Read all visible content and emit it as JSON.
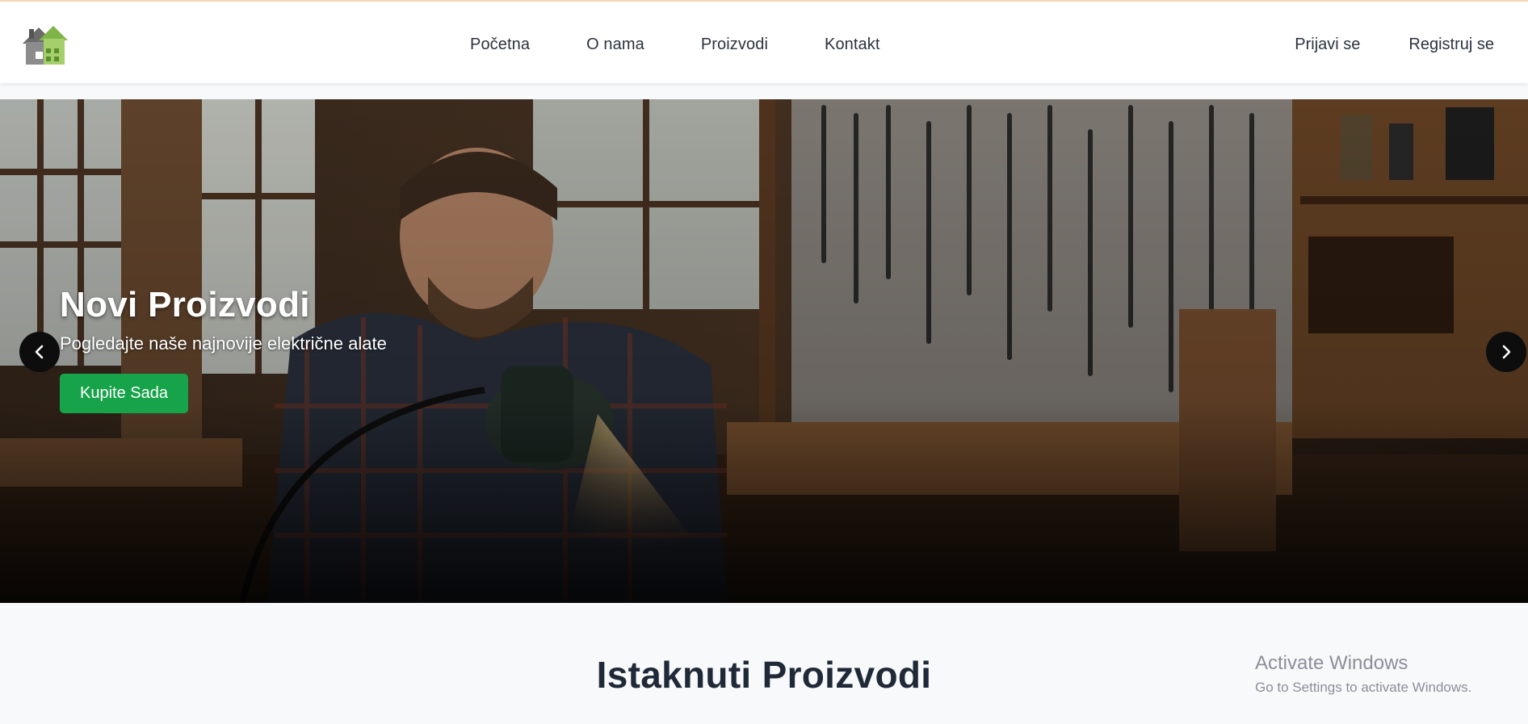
{
  "nav": {
    "links": [
      {
        "label": "Početna"
      },
      {
        "label": "O nama"
      },
      {
        "label": "Proizvodi"
      },
      {
        "label": "Kontakt"
      }
    ],
    "login_label": "Prijavi se",
    "register_label": "Registruj se"
  },
  "hero": {
    "title": "Novi Proizvodi",
    "subtitle": "Pogledajte naše najnovije električne alate",
    "cta_label": "Kupite Sada",
    "prev_icon": "chevron-left-icon",
    "next_icon": "chevron-right-icon"
  },
  "featured": {
    "title": "Istaknuti Proizvodi"
  },
  "watermark": {
    "title": "Activate Windows",
    "subtitle": "Go to Settings to activate Windows."
  },
  "colors": {
    "accent": "#16a34a",
    "nav_text": "#2b3340",
    "section_bg": "#f8f9fb"
  }
}
